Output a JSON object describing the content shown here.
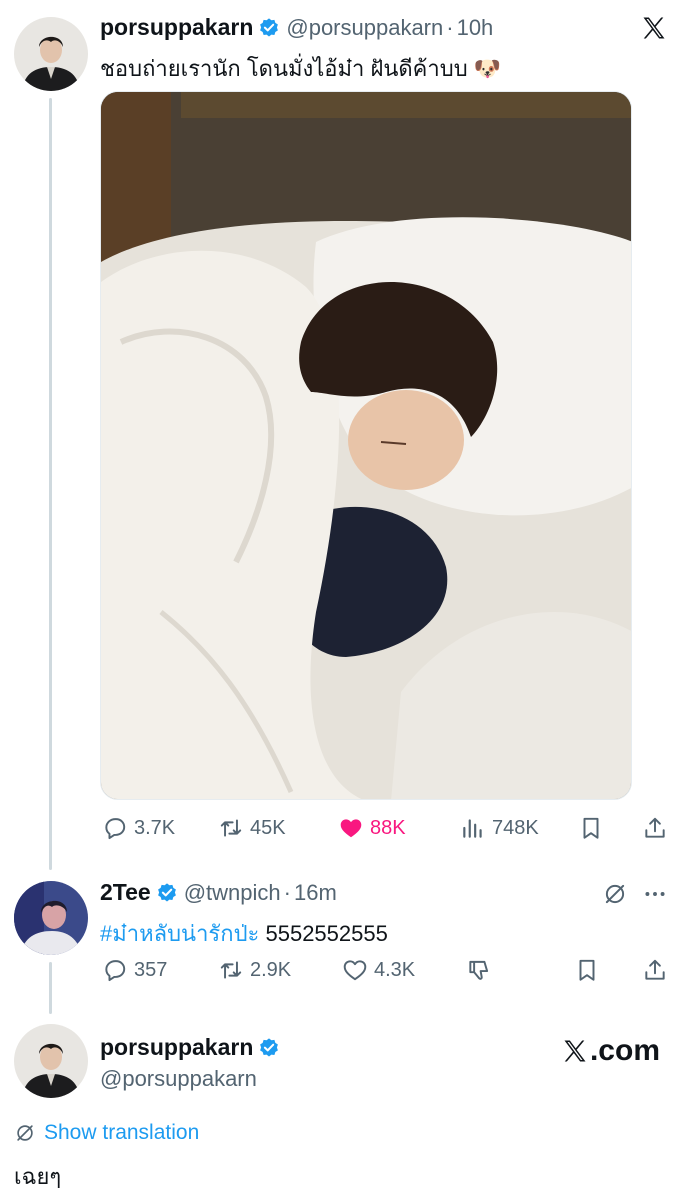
{
  "tweet1": {
    "display_name": "porsuppakarn",
    "handle": "@porsuppakarn",
    "dot": "·",
    "time": "10h",
    "text": "ชอบถ่ายเรานัก โดนมั่งไอ้ม๋า ฝันดีค้าบบ",
    "emoji": "🐶",
    "stats": {
      "replies": "3.7K",
      "reposts": "45K",
      "likes": "88K",
      "views": "748K"
    },
    "liked": true
  },
  "tweet2": {
    "display_name": "2Tee",
    "handle": "@twnpich",
    "dot": "·",
    "time": "16m",
    "hashtag": "#ม๋าหลับน่ารักป่ะ",
    "text": "5552552555",
    "stats": {
      "replies": "357",
      "reposts": "2.9K",
      "likes": "4.3K"
    }
  },
  "reply": {
    "display_name": "porsuppakarn",
    "handle": "@porsuppakarn",
    "brand": ".com",
    "show_translation": "Show translation",
    "text": "เฉยๆ"
  },
  "colors": {
    "accent": "#1d9bf0",
    "like": "#f91880",
    "muted": "#536471",
    "thread": "#cfd9de"
  }
}
